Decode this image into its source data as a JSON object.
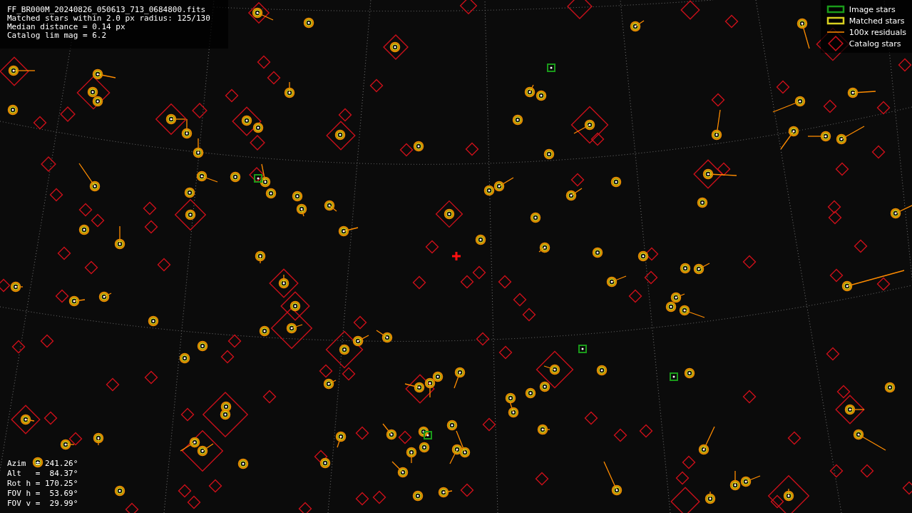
{
  "header": {
    "lines": [
      "FF_BR000M_20240826_050613_713_0684800.fits",
      "Matched stars within 2.0 px radius: 125/130",
      "Median distance = 0.14 px",
      "Catalog lim mag = 6.2"
    ]
  },
  "legend": [
    {
      "kind": "image",
      "label": "Image stars"
    },
    {
      "kind": "matched",
      "label": "Matched stars"
    },
    {
      "kind": "residual",
      "label": "100x residuals"
    },
    {
      "kind": "catalog",
      "label": "Catalog stars"
    }
  ],
  "pointing": {
    "lines": [
      "Azim  = 241.26°",
      "Alt   =  84.37°",
      "Rot h = 170.25°",
      "FOV h =  53.69°",
      "FOV v =  29.99°"
    ]
  }
}
